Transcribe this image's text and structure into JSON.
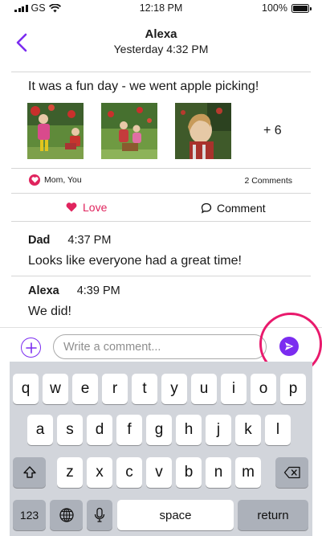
{
  "status_bar": {
    "carrier": "GS",
    "time": "12:18 PM",
    "battery": "100%"
  },
  "header": {
    "title": "Alexa",
    "subtitle": "Yesterday 4:32 PM"
  },
  "post": {
    "text": "It was a fun day - we went apple picking!",
    "more_photos": "+ 6"
  },
  "reactions": {
    "people": "Mom, You",
    "comments_count": "2 Comments"
  },
  "actions": {
    "love": "Love",
    "comment": "Comment"
  },
  "comments": [
    {
      "author": "Dad",
      "time": "4:37 PM",
      "body": "Looks like everyone had a great time!"
    },
    {
      "author": "Alexa",
      "time": "4:39 PM",
      "body": "We did!"
    }
  ],
  "input": {
    "placeholder": "Write a comment..."
  },
  "keyboard": {
    "row1": [
      "q",
      "w",
      "e",
      "r",
      "t",
      "y",
      "u",
      "i",
      "o",
      "p"
    ],
    "row2": [
      "a",
      "s",
      "d",
      "f",
      "g",
      "h",
      "j",
      "k",
      "l"
    ],
    "row3": [
      "z",
      "x",
      "c",
      "v",
      "b",
      "n",
      "m"
    ],
    "numbers_key": "123",
    "space_key": "space",
    "return_key": "return"
  },
  "colors": {
    "accent": "#7b2cf0",
    "love": "#e0245e",
    "highlight_ring": "#e9196c"
  }
}
